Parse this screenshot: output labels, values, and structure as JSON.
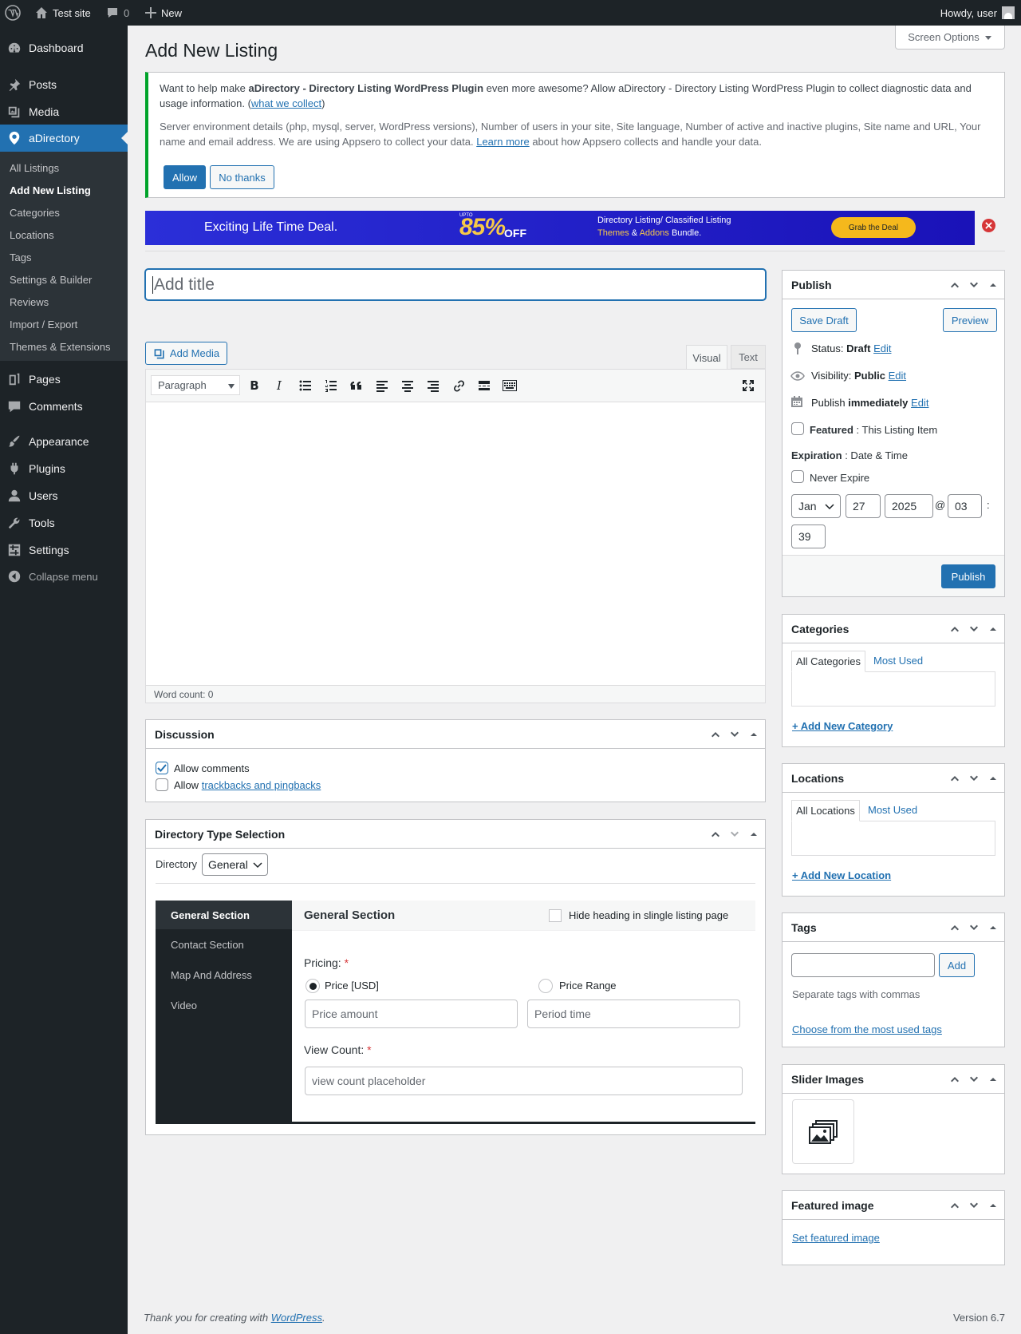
{
  "admin_bar": {
    "site_name": "Test site",
    "comments_count": "0",
    "new_label": "New",
    "howdy": "Howdy, user"
  },
  "sidebar": {
    "dashboard": "Dashboard",
    "posts": "Posts",
    "media": "Media",
    "adirectory": "aDirectory",
    "submenu": [
      "All Listings",
      "Add New Listing",
      "Categories",
      "Locations",
      "Tags",
      "Settings & Builder",
      "Reviews",
      "Import / Export",
      "Themes & Extensions"
    ],
    "pages": "Pages",
    "comments": "Comments",
    "appearance": "Appearance",
    "plugins": "Plugins",
    "users": "Users",
    "tools": "Tools",
    "settings": "Settings",
    "collapse": "Collapse menu"
  },
  "screen_options": "Screen Options",
  "page_title": "Add New Listing",
  "notice": {
    "text_1": "Want to help make",
    "plugin_name": "aDirectory - Directory Listing WordPress Plugin",
    "text_2": "even more awesome? Allow aDirectory - Directory Listing WordPress Plugin to collect diagnostic data and usage information. (",
    "what_we_collect": "what we collect",
    "text_3": ")",
    "details_1": "Server environment details (php, mysql, server, WordPress versions), Number of users in your site, Site language, Number of active and inactive plugins, Site name and URL, Your name and email address. We are using Appsero to collect your data.",
    "learn_more": "Learn more",
    "details_2": "about how Appsero collects and handle your data.",
    "allow": "Allow",
    "no_thanks": "No thanks"
  },
  "banner": {
    "headline": "Exciting Life Time Deal.",
    "upto": "UPTO",
    "discount": "85%",
    "off": "OFF",
    "line1": "Directory Listing/ Classified Listing",
    "line2_a": "Themes",
    "line2_amp": " & ",
    "line2_b": "Addons",
    "line2_c": " Bundle.",
    "cta": "Grab the Deal",
    "colors": {
      "bg_from": "#2b2fd8",
      "bg_to": "#1a12b8",
      "discount": "#f7c948",
      "cta_bg": "#f5b81c"
    }
  },
  "editor": {
    "title_placeholder": "Add title",
    "add_media": "Add Media",
    "tab_visual": "Visual",
    "tab_text": "Text",
    "format_select": "Paragraph",
    "word_count": "Word count: 0"
  },
  "discussion": {
    "title": "Discussion",
    "allow_comments": "Allow comments",
    "allow_prefix": "Allow",
    "trackbacks_link": "trackbacks and pingbacks",
    "allow_comments_checked": true,
    "trackbacks_checked": false
  },
  "directory_type": {
    "title": "Directory Type Selection",
    "label": "Directory",
    "selected": "General",
    "tabs": [
      "General Section",
      "Contact Section",
      "Map And Address",
      "Video"
    ],
    "section_heading": "General Section",
    "hide_heading_label": "Hide heading in slingle listing page",
    "pricing_label": "Pricing:",
    "required_mark": "*",
    "price_option_1": "Price [USD]",
    "price_option_2": "Price Range",
    "price_amount_placeholder": "Price amount",
    "period_time_placeholder": "Period time",
    "view_count_label": "View Count:",
    "view_count_placeholder": "view count placeholder"
  },
  "publish": {
    "title": "Publish",
    "save_draft": "Save Draft",
    "preview": "Preview",
    "status_label": "Status:",
    "status_value": "Draft",
    "visibility_label": "Visibility:",
    "visibility_value": "Public",
    "publish_label": "Publish",
    "publish_value": "immediately",
    "edit": "Edit",
    "featured_label": "Featured",
    "featured_suffix": ": This Listing Item",
    "expiration_label": "Expiration",
    "expiration_suffix": ": Date & Time",
    "never_expire": "Never Expire",
    "month": "Jan",
    "day": "27",
    "year": "2025",
    "at": "@",
    "hour": "03",
    "colon": ":",
    "minute": "39",
    "publish_button": "Publish"
  },
  "categories": {
    "title": "Categories",
    "tab_all": "All Categories",
    "tab_most_used": "Most Used",
    "add_new": "+ Add New Category"
  },
  "locations": {
    "title": "Locations",
    "tab_all": "All Locations",
    "tab_most_used": "Most Used",
    "add_new": "+ Add New Location"
  },
  "tags": {
    "title": "Tags",
    "add": "Add",
    "hint": "Separate tags with commas",
    "choose": "Choose from the most used tags"
  },
  "slider_images": {
    "title": "Slider Images"
  },
  "featured_image": {
    "title": "Featured image",
    "set": "Set featured image"
  },
  "footer": {
    "thanks": "Thank you for creating with",
    "wordpress": "WordPress",
    "period": ".",
    "version": "Version 6.7"
  },
  "colors": {
    "accent": "#2271b1",
    "sidebar": "#1d2327",
    "submenu": "#2c3338",
    "notice_border": "#00a32a",
    "required": "#d63638"
  }
}
